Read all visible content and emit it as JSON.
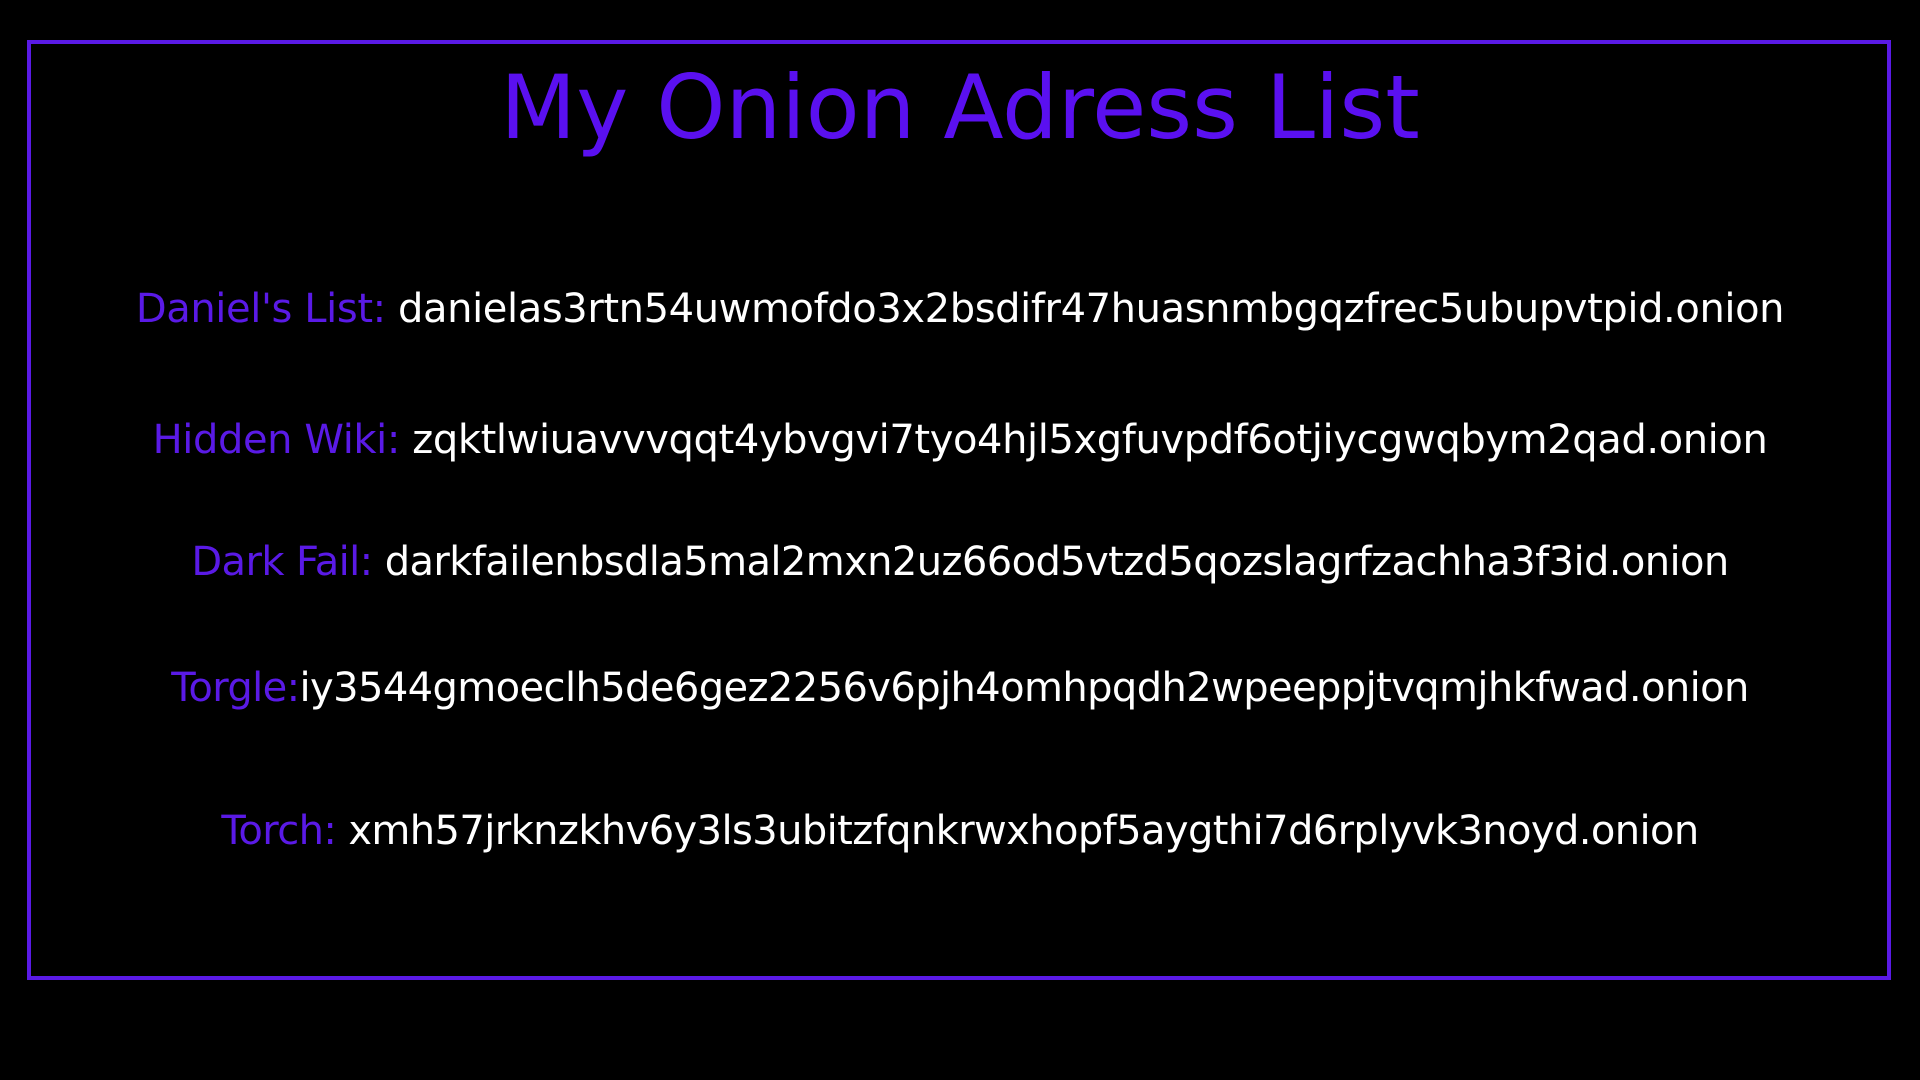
{
  "title": "My Onion Adress List",
  "colors": {
    "background": "#000000",
    "accent": "#5A1AE6",
    "address_text": "#FFFFFF"
  },
  "entries": [
    {
      "label": "Daniel's List:",
      "address": "danielas3rtn54uwmofdo3x2bsdifr47huasnmbgqzfrec5ubupvtpid.onion"
    },
    {
      "label": "Hidden Wiki:",
      "address": "zqktlwiuavvvqqt4ybvgvi7tyo4hjl5xgfuvpdf6otjiycgwqbym2qad.onion"
    },
    {
      "label": "Dark Fail:",
      "address": "darkfailenbsdla5mal2mxn2uz66od5vtzd5qozslagrfzachha3f3id.onion"
    },
    {
      "label": "Torgle:",
      "address": "iy3544gmoeclh5de6gez2256v6pjh4omhpqdh2wpeeppjtvqmjhkfwad.onion"
    },
    {
      "label": "Torch:",
      "address": "xmh57jrknzkhv6y3ls3ubitzfqnkrwxhopf5aygthi7d6rplyvk3noyd.onion"
    }
  ]
}
